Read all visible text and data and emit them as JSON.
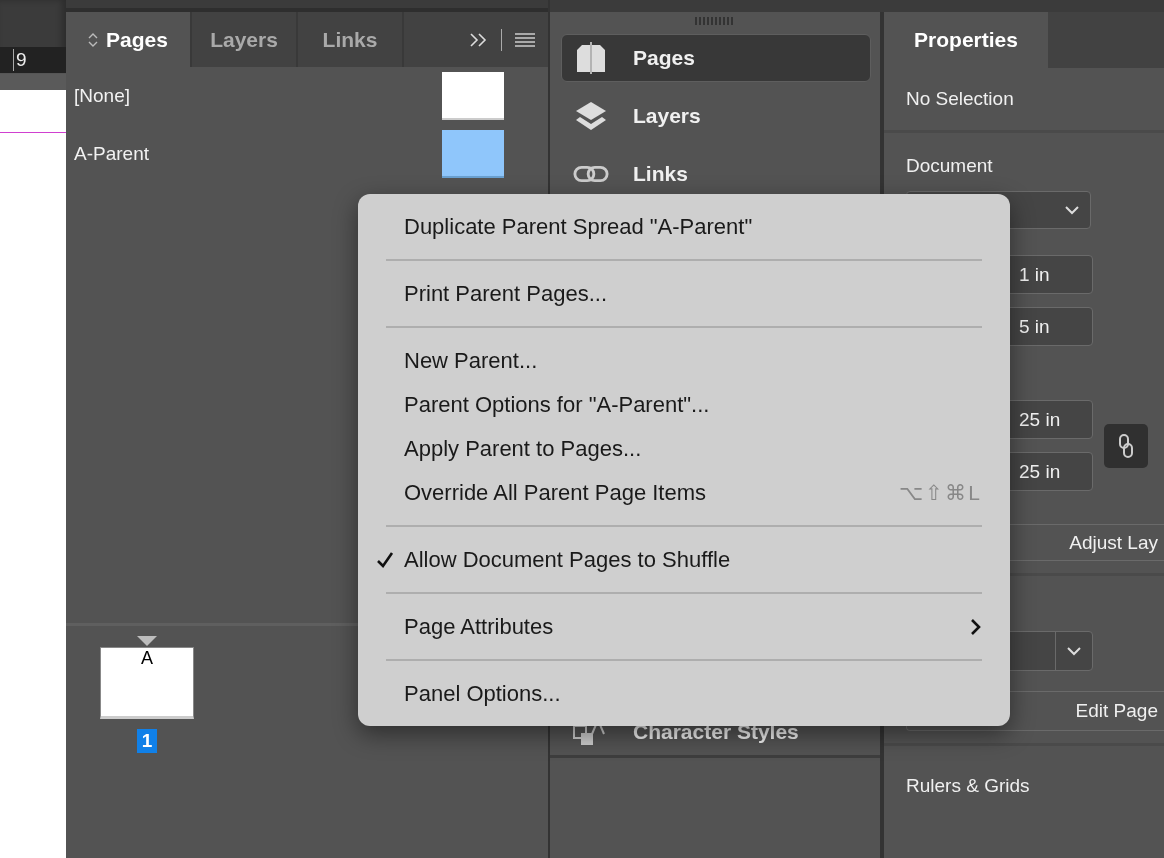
{
  "canvas": {
    "ruler_label": "9"
  },
  "pages_panel": {
    "tabs": [
      {
        "label": "Pages",
        "selected": true
      },
      {
        "label": "Layers",
        "selected": false
      },
      {
        "label": "Links",
        "selected": false
      }
    ],
    "parents": [
      {
        "name": "[None]",
        "selected": false
      },
      {
        "name": "A-Parent",
        "selected": true
      }
    ],
    "pages": [
      {
        "prefix": "A",
        "number": "1",
        "selected": true
      }
    ]
  },
  "dock": {
    "items": [
      {
        "label": "Pages",
        "selected": true
      },
      {
        "label": "Layers",
        "selected": false
      },
      {
        "label": "Links",
        "selected": false
      }
    ],
    "bottom_item": {
      "label": "Character Styles"
    }
  },
  "properties": {
    "tabs": [
      {
        "label": "Properties",
        "selected": true
      }
    ],
    "selection": "No Selection",
    "section": "Document",
    "fields": [
      "1 in",
      "5 in",
      "25 in",
      "25 in"
    ],
    "adjust_button": "Adjust Lay",
    "edit_button": "Edit Page",
    "rulers": "Rulers & Grids"
  },
  "menu": {
    "groups": [
      [
        {
          "label": "Duplicate Parent Spread \"A-Parent\"",
          "checked": false,
          "submenu": false
        }
      ],
      [
        {
          "label": "Print Parent Pages...",
          "checked": false,
          "submenu": false
        }
      ],
      [
        {
          "label": "New Parent...",
          "checked": false,
          "submenu": false
        },
        {
          "label": "Parent Options for \"A-Parent\"...",
          "checked": false,
          "submenu": false
        },
        {
          "label": "Apply Parent to Pages...",
          "checked": false,
          "submenu": false
        },
        {
          "label": "Override All Parent Page Items",
          "checked": false,
          "submenu": false,
          "shortcut": "⌥⇧⌘L"
        }
      ],
      [
        {
          "label": "Allow Document Pages to Shuffle",
          "checked": true,
          "submenu": false
        }
      ],
      [
        {
          "label": "Page Attributes",
          "checked": false,
          "submenu": true
        }
      ],
      [
        {
          "label": "Panel Options...",
          "checked": false,
          "submenu": false
        }
      ]
    ]
  }
}
